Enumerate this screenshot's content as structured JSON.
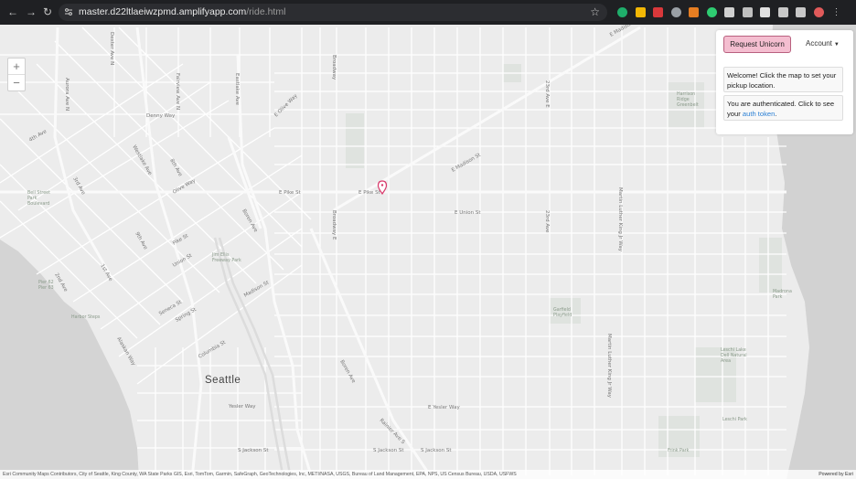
{
  "browser": {
    "url_host": "master.d22ltlaeiwzpmd.amplifyapp.com",
    "url_path": "/ride.html",
    "nav": [
      "back-icon",
      "forward-icon",
      "reload-icon"
    ],
    "extensions": [
      {
        "name": "extension-green-icon",
        "color": "#1fae6b"
      },
      {
        "name": "extension-yellow-icon",
        "color": "#f2b705"
      },
      {
        "name": "extension-red-icon",
        "color": "#d9383b"
      },
      {
        "name": "extension-gray-icon",
        "color": "#9aa0a6"
      },
      {
        "name": "extension-orange-icon",
        "color": "#e67e22"
      },
      {
        "name": "extension-green2-icon",
        "color": "#2ecc71"
      },
      {
        "name": "extension-white-icon",
        "color": "#d0d0d0"
      },
      {
        "name": "extension-white2-icon",
        "color": "#bfbfbf"
      },
      {
        "name": "extension-white3-icon",
        "color": "#e0e0e0"
      },
      {
        "name": "extension-puzzle-icon",
        "color": "#c8c8c8"
      },
      {
        "name": "sidebar-toggle-icon",
        "color": "#c8c8c8"
      },
      {
        "name": "profile-icon",
        "color": "#e05a5a"
      },
      {
        "name": "menu-icon",
        "color": "#c8c8c8"
      }
    ]
  },
  "map": {
    "zoom_in": "+",
    "zoom_out": "−",
    "city_label": "Seattle",
    "streets": [
      "Denny Way",
      "Olive Way",
      "E Pike St",
      "E Pike St",
      "E Madison St",
      "E Union St",
      "Pike St",
      "Union St",
      "Seneca St",
      "Spring St",
      "Madison St",
      "Columbia St",
      "Yesler Way",
      "E Yesler Way",
      "S Jackson St",
      "S Jackson St",
      "S Jackson St",
      "Boren Ave",
      "Broadway",
      "23rd Ave",
      "23rd Ave E",
      "Martin Luther King Jr Way",
      "Martin Luther King Jr Way",
      "4th Ave",
      "2nd Ave",
      "3rd Ave",
      "1st Ave",
      "Alaskan Way",
      "Fairview Ave N",
      "Eastlake Ave",
      "Westlake Ave",
      "8th Ave",
      "9th Ave",
      "Dexter Ave N",
      "Aurora Ave N",
      "Boren Ave",
      "E Olive Way",
      "Broadway E",
      "Rainier Ave S",
      "E Madison St"
    ],
    "parks": [
      "Bell Street Park Boulevard",
      "Pier 62",
      "Pier 63",
      "Harbor Steps",
      "Jim Ellis Freeway Park",
      "Garfield Playfield",
      "Harrison Ridge Greenbelt",
      "Leschi Lake Dell Natural Area",
      "Leschi Park",
      "Frink Park",
      "Madrona Park"
    ],
    "attribution": "Esri Community Maps Contributors, City of Seattle, King County, WA State Parks GIS, Esri, TomTom, Garmin, SafeGraph, GeoTechnologies, Inc, METI/NASA, USGS, Bureau of Land Management, EPA, NPS, US Census Bureau, USDA, USFWS",
    "powered_by": "Powered by Esri"
  },
  "panel": {
    "request_button": "Request Unicorn",
    "account_label": "Account",
    "welcome_message": "Welcome! Click the map to set your pickup location.",
    "auth_message_prefix": "You are authenticated. Click to see your ",
    "auth_link": "auth token",
    "auth_message_suffix": "."
  }
}
